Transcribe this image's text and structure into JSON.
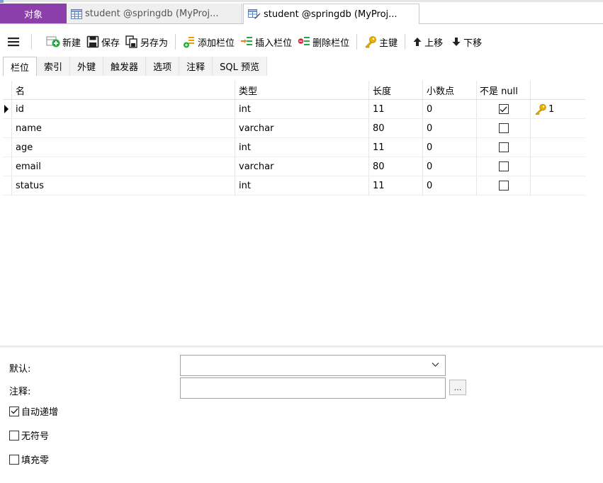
{
  "tabs": {
    "objects": "对象",
    "doc1": "student @springdb (MyProj...",
    "doc2": "student @springdb (MyProj..."
  },
  "toolbar": {
    "new": "新建",
    "save": "保存",
    "save_as": "另存为",
    "add_field": "添加栏位",
    "insert_field": "插入栏位",
    "delete_field": "删除栏位",
    "primary_key": "主键",
    "move_up": "上移",
    "move_down": "下移"
  },
  "subtabs": [
    "栏位",
    "索引",
    "外键",
    "触发器",
    "选项",
    "注释",
    "SQL 预览"
  ],
  "grid": {
    "headers": {
      "name": "名",
      "type": "类型",
      "length": "长度",
      "decimals": "小数点",
      "not_null": "不是 null"
    },
    "rows": [
      {
        "name": "id",
        "type": "int",
        "length": "11",
        "decimals": "0",
        "not_null": true,
        "key": "1"
      },
      {
        "name": "name",
        "type": "varchar",
        "length": "80",
        "decimals": "0",
        "not_null": false,
        "key": ""
      },
      {
        "name": "age",
        "type": "int",
        "length": "11",
        "decimals": "0",
        "not_null": false,
        "key": ""
      },
      {
        "name": "email",
        "type": "varchar",
        "length": "80",
        "decimals": "0",
        "not_null": false,
        "key": ""
      },
      {
        "name": "status",
        "type": "int",
        "length": "11",
        "decimals": "0",
        "not_null": false,
        "key": ""
      }
    ]
  },
  "props": {
    "default_label": "默认:",
    "default_value": "",
    "comment_label": "注释:",
    "comment_value": "",
    "ellipsis": "...",
    "auto_increment": "自动递增",
    "unsigned": "无符号",
    "zerofill": "填充零"
  },
  "options": {
    "auto_increment": true,
    "unsigned": false,
    "zerofill": false
  },
  "colors": {
    "accent_purple": "#8c3faa",
    "key_gold": "#e8b400",
    "new_green": "#27a844",
    "delete_red": "#e0253a",
    "insert_orange": "#f07a1a"
  }
}
